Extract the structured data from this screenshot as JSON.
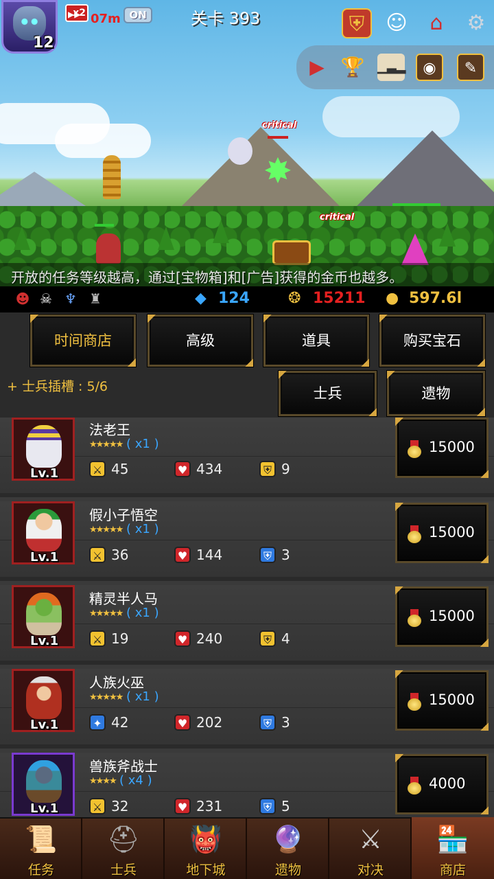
{
  "hud": {
    "hero_level": "12",
    "speed_multiplier": "x2",
    "speed_time": "07m",
    "speed_toggle": "ON",
    "stage": "关卡 393",
    "top_icons": [
      "shield-icon",
      "angel-icon",
      "house-icon",
      "gear-icon"
    ],
    "row_icons": [
      "play-icon",
      "trophy-icon",
      "podium-icon",
      "book-icon",
      "quest-book-icon"
    ]
  },
  "battle": {
    "critical_labels": [
      "critical",
      "critical"
    ],
    "tip": "开放的任务等级越高，通过[宝物箱]和[广告]获得的金币也越多。"
  },
  "resources": {
    "diamond": "124",
    "medal": "15211",
    "gold": "597.6l",
    "colors": {
      "diamond": "#3aa6ff",
      "medal": "#e52020",
      "gold": "#f0c040"
    }
  },
  "tabs": {
    "main": [
      "时间商店",
      "高级",
      "道具",
      "购买宝石"
    ],
    "slot_label": "+ 士兵插槽 : 5/6",
    "sub": [
      "士兵",
      "遗物"
    ]
  },
  "units": [
    {
      "name": "法老王",
      "stars": "★★★★★",
      "mult": "( x1 )",
      "lv": "Lv.1",
      "stats": [
        "45",
        "434",
        "9"
      ],
      "price": "15000"
    },
    {
      "name": "假小子悟空",
      "stars": "★★★★★",
      "mult": "( x1 )",
      "lv": "Lv.1",
      "stats": [
        "36",
        "144",
        "3"
      ],
      "price": "15000"
    },
    {
      "name": "精灵半人马",
      "stars": "★★★★★",
      "mult": "( x1 )",
      "lv": "Lv.1",
      "stats": [
        "19",
        "240",
        "4"
      ],
      "price": "15000"
    },
    {
      "name": "人族火巫",
      "stars": "★★★★★",
      "mult": "( x1 )",
      "lv": "Lv.1",
      "stats": [
        "42",
        "202",
        "3"
      ],
      "price": "15000"
    },
    {
      "name": "兽族斧战士",
      "stars": "★★★★",
      "mult": "( x4 )",
      "lv": "Lv.1",
      "stats": [
        "32",
        "231",
        "5"
      ],
      "price": "4000"
    }
  ],
  "nav": [
    "任务",
    "士兵",
    "地下城",
    "遗物",
    "对决",
    "商店"
  ]
}
